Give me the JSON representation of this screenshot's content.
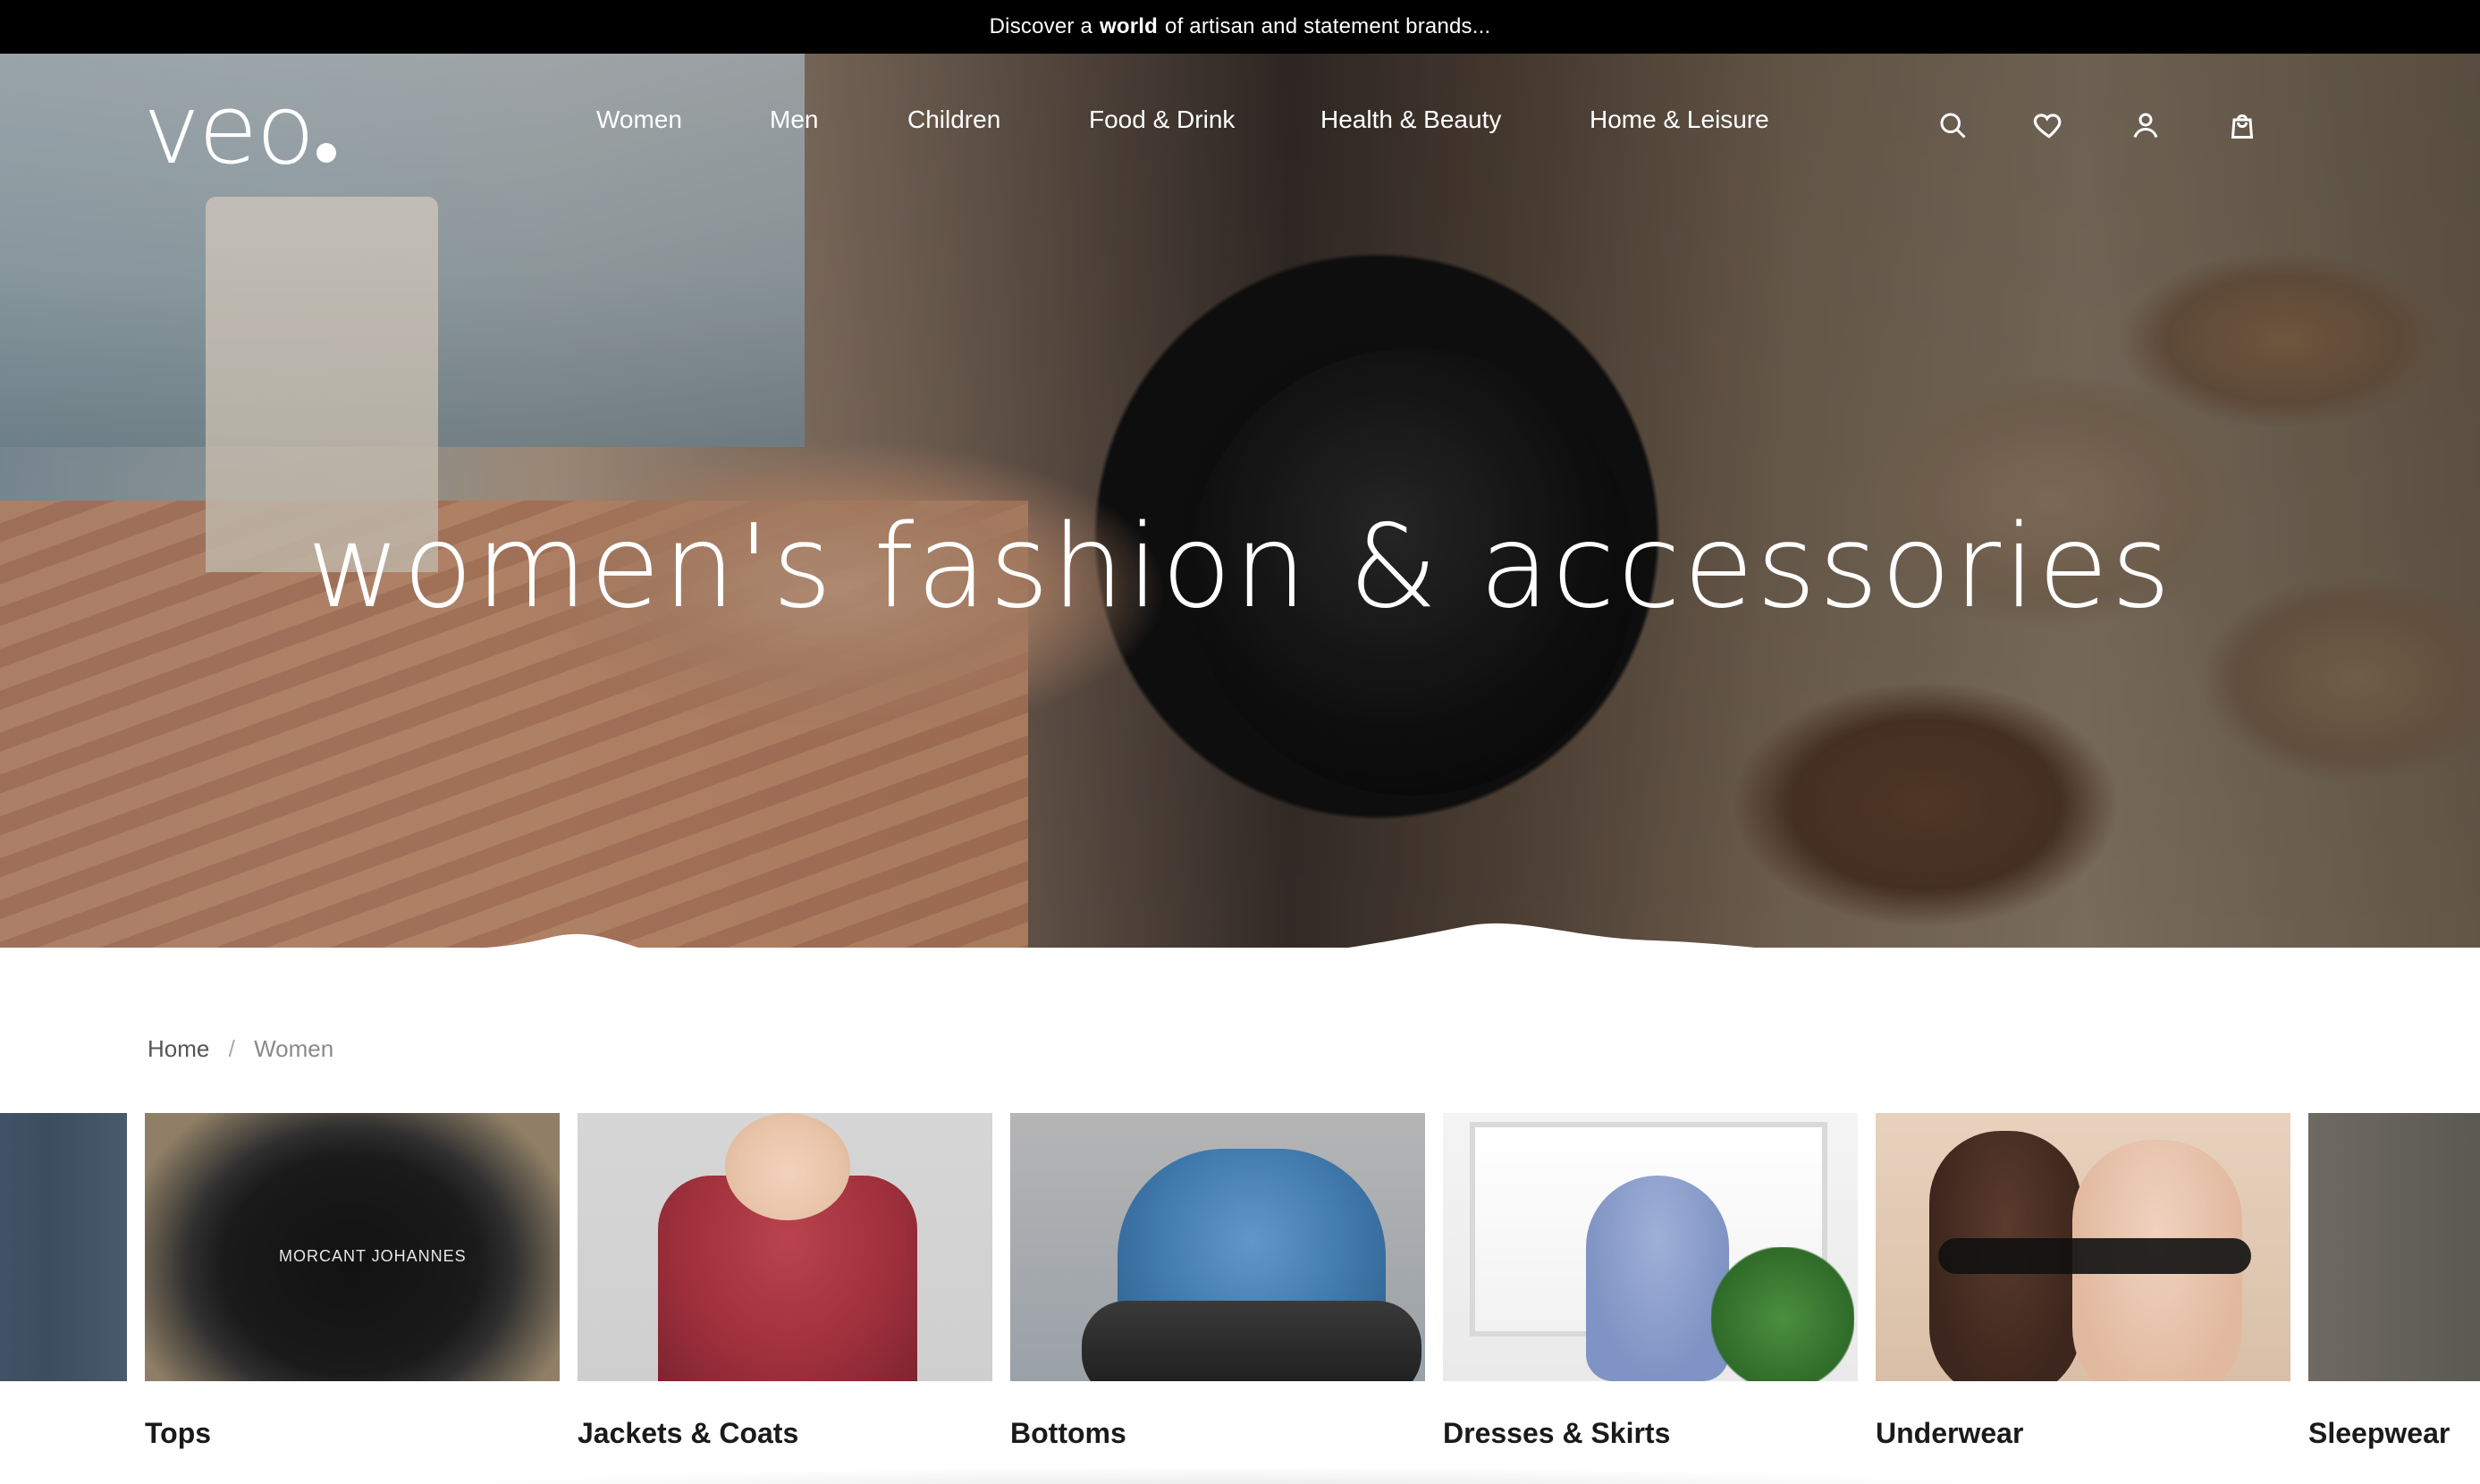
{
  "announcement": {
    "prefix": "Discover a",
    "bold": "world",
    "suffix": "of artisan and statement brands..."
  },
  "brand": {
    "logo_text": "veo"
  },
  "nav": {
    "items": [
      {
        "label": "Women"
      },
      {
        "label": "Men"
      },
      {
        "label": "Children"
      },
      {
        "label": "Food & Drink"
      },
      {
        "label": "Health & Beauty"
      },
      {
        "label": "Home & Leisure"
      }
    ]
  },
  "header_icons": [
    {
      "name": "search-icon"
    },
    {
      "name": "heart-icon"
    },
    {
      "name": "user-icon"
    },
    {
      "name": "bag-icon"
    }
  ],
  "hero": {
    "title": "women's fashion & accessories"
  },
  "breadcrumb": {
    "home": "Home",
    "separator": "/",
    "current": "Women"
  },
  "categories": [
    {
      "label": "Tops",
      "image_text": "MORCANT JOHANNES"
    },
    {
      "label": "Jackets & Coats"
    },
    {
      "label": "Bottoms"
    },
    {
      "label": "Dresses & Skirts"
    },
    {
      "label": "Underwear"
    },
    {
      "label": "Sleepwear"
    }
  ],
  "colors": {
    "announcement_bg": "#000000",
    "text_dark": "#1a1a1a",
    "breadcrumb_muted": "#8a8a8a"
  }
}
